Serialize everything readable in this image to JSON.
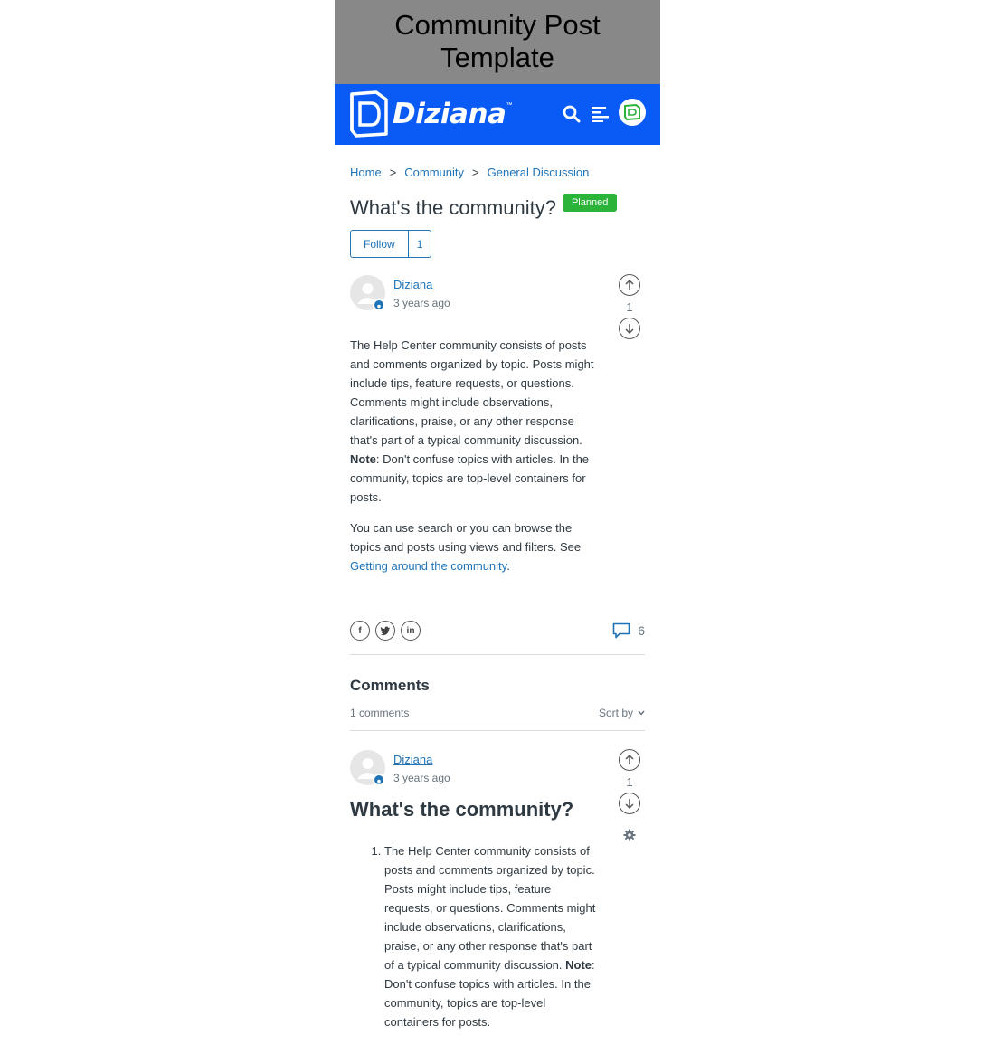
{
  "banner": {
    "title_line1": "Community Post",
    "title_line2": "Template"
  },
  "header": {
    "brand": "Diziana",
    "brand_tm": "™"
  },
  "breadcrumb": {
    "items": [
      "Home",
      "Community",
      "General Discussion"
    ],
    "separator": ">"
  },
  "post": {
    "title": "What's the community?",
    "status_badge": "Planned",
    "follow_label": "Follow",
    "follow_count": "1",
    "author": "Diziana",
    "time": "3 years ago",
    "votes": "1",
    "para1_text": "The Help Center community consists of posts and comments organized by topic. Posts might include tips, feature requests, or questions. Comments might include observations, clarifications, praise, or any other response that's part of a typical community discussion. ",
    "para1_bold": "Note",
    "para1_tail": ": Don't confuse topics with articles. In the community, topics are top-level containers for posts.",
    "para2_text": "You can use search or you can browse the topics and posts using views and filters. See ",
    "para2_link": "Getting around the community",
    "para2_tail": ".",
    "comment_count": "6"
  },
  "comments": {
    "heading": "Comments",
    "count_label": "1 comments",
    "sort_label": "Sort by",
    "items": [
      {
        "author": "Diziana",
        "time": "3 years ago",
        "votes": "1",
        "title": "What's the community?",
        "list_text": "The Help Center community consists of posts and comments organized by topic. Posts might include tips, feature requests, or questions. Comments might include observations, clarifications, praise, or any other response that's part of a typical community discussion. ",
        "list_bold": "Note",
        "list_tail": ": Don't confuse topics with articles. In the community, topics are top-level containers for posts."
      }
    ]
  },
  "colors": {
    "header_bg": "#0a5bf5",
    "banner_bg": "#888888",
    "link": "#1f73b7",
    "badge_bg": "#2bb33a"
  }
}
